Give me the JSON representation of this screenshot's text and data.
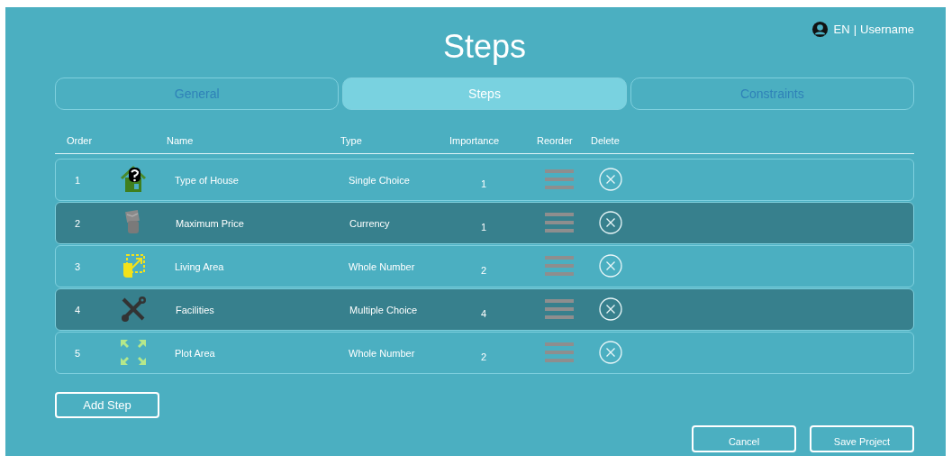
{
  "header": {
    "title": "Steps",
    "language": "EN",
    "separator": "|",
    "user": "Username"
  },
  "tabs": [
    {
      "label": "General",
      "selected": false
    },
    {
      "label": "Steps",
      "selected": true
    },
    {
      "label": "Constraints",
      "selected": false
    }
  ],
  "table": {
    "columns": [
      "Order",
      "Name",
      "Type",
      "Importance",
      "Reorder",
      "Delete"
    ],
    "rows": [
      {
        "order": "1",
        "kind": "house",
        "name": "Type of House",
        "type": "Single Choice",
        "importance": "1",
        "highlighted": false
      },
      {
        "order": "2",
        "kind": "money",
        "name": "Maximum Price",
        "type": "Currency",
        "importance": "1",
        "highlighted": true
      },
      {
        "order": "3",
        "kind": "area",
        "name": "Living Area",
        "type": "Whole Number",
        "importance": "2",
        "highlighted": false
      },
      {
        "order": "4",
        "kind": "tools",
        "name": "Facilities",
        "type": "Multiple Choice",
        "importance": "4",
        "highlighted": true
      },
      {
        "order": "5",
        "kind": "expand",
        "name": "Plot Area",
        "type": "Whole Number",
        "importance": "2",
        "highlighted": false
      }
    ]
  },
  "add_button": "Add Step",
  "footer_buttons": [
    "Cancel",
    "Save Project"
  ]
}
